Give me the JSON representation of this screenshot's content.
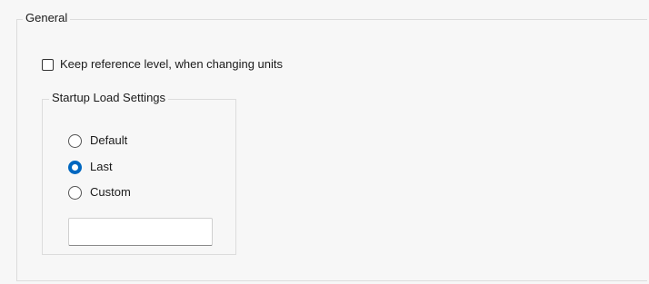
{
  "general_group": {
    "title": "General",
    "keep_reference_checkbox": {
      "label": "Keep reference level, when changing units",
      "checked": false
    },
    "startup_group": {
      "title": "Startup Load Settings",
      "options": [
        {
          "label": "Default",
          "checked": false
        },
        {
          "label": "Last",
          "checked": true
        },
        {
          "label": "Custom",
          "checked": false
        }
      ],
      "custom_value": ""
    }
  },
  "colors": {
    "accent": "#0067c0",
    "panel_background": "#f7f7f7",
    "group_border": "#dcdcdc"
  }
}
